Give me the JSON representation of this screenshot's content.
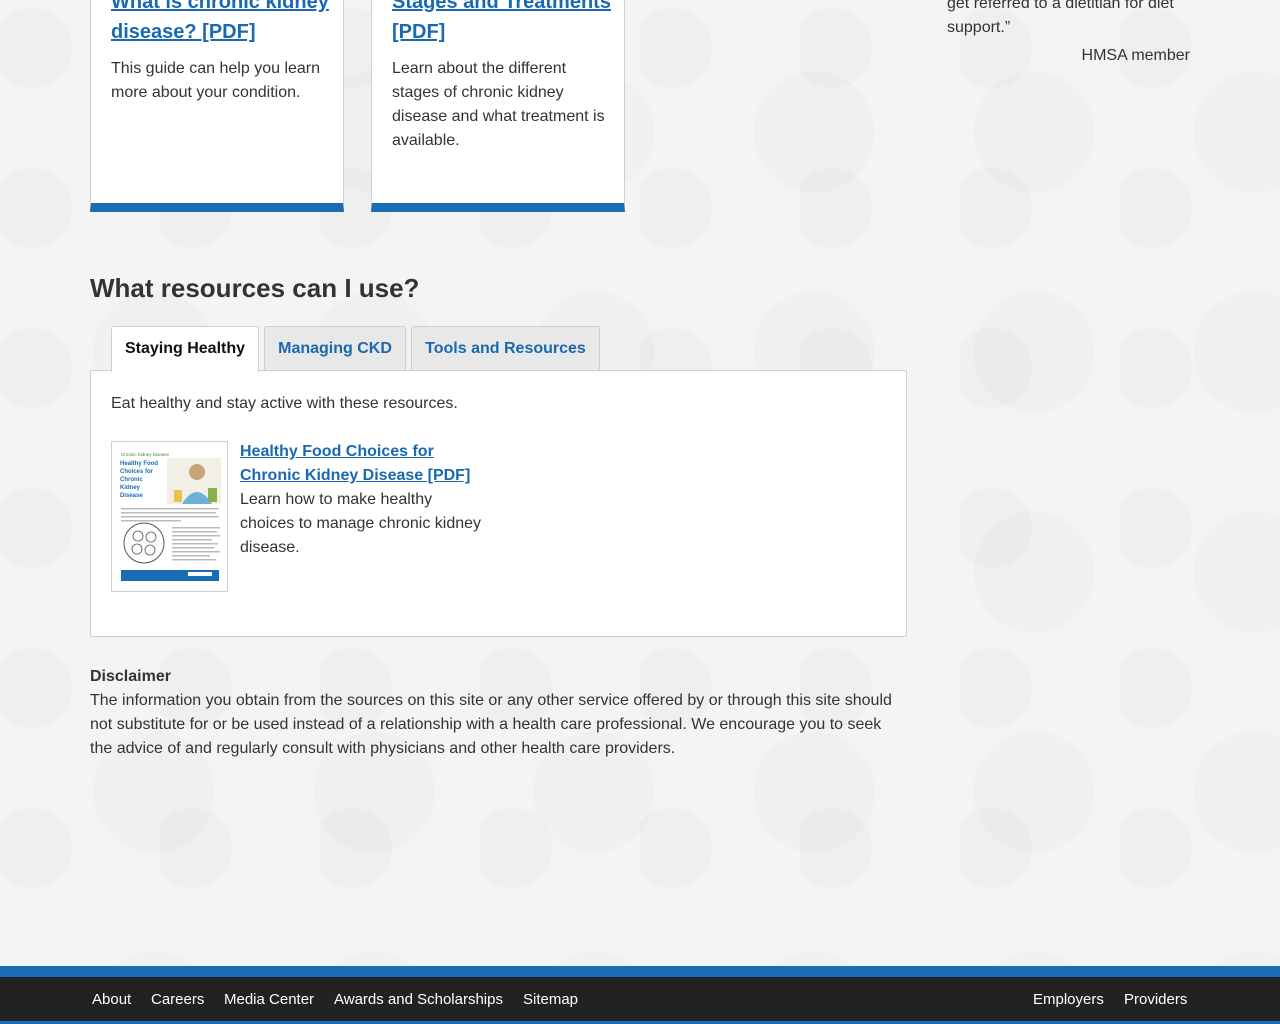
{
  "cards": [
    {
      "title": "What is chronic kidney disease? [PDF]",
      "description": "This guide can help you learn more about your condition."
    },
    {
      "title": "Stages and Treatments [PDF]",
      "description": "Learn about the different stages of chronic kidney disease and what treatment is available."
    }
  ],
  "testimonial": {
    "text": "get referred to a dietitian for diet support.”",
    "author": "HMSA member"
  },
  "resources": {
    "heading": "What resources can I use?",
    "tabs": [
      {
        "label": "Staying Healthy",
        "active": true
      },
      {
        "label": "Managing CKD",
        "active": false
      },
      {
        "label": "Tools and Resources",
        "active": false
      }
    ],
    "panel": {
      "intro": "Eat healthy and stay active with these resources.",
      "item": {
        "title": "Healthy Food Choices for Chronic Kidney Disease [PDF]",
        "description": "Learn how to make healthy choices to manage chronic kidney disease.",
        "thumbnail": {
          "header": "Chronic Kidney Disease",
          "title": "Healthy Food Choices for Chronic Kidney Disease"
        }
      }
    }
  },
  "disclaimer": {
    "title": "Disclaimer",
    "text": "The information you obtain from the sources on this site or any other service offered by or through this site should not substitute for or be used instead of a relationship with a health care professional. We encourage you to seek the advice of and regularly consult with physicians and other health care providers."
  },
  "footer": {
    "left_links": [
      "About",
      "Careers",
      "Media Center",
      "Awards and Scholarships",
      "Sitemap"
    ],
    "right_links": [
      "Employers",
      "Providers"
    ]
  },
  "colors": {
    "link": "#1a69b0",
    "accent": "#1a6cb5",
    "footer_bg": "#222222"
  }
}
